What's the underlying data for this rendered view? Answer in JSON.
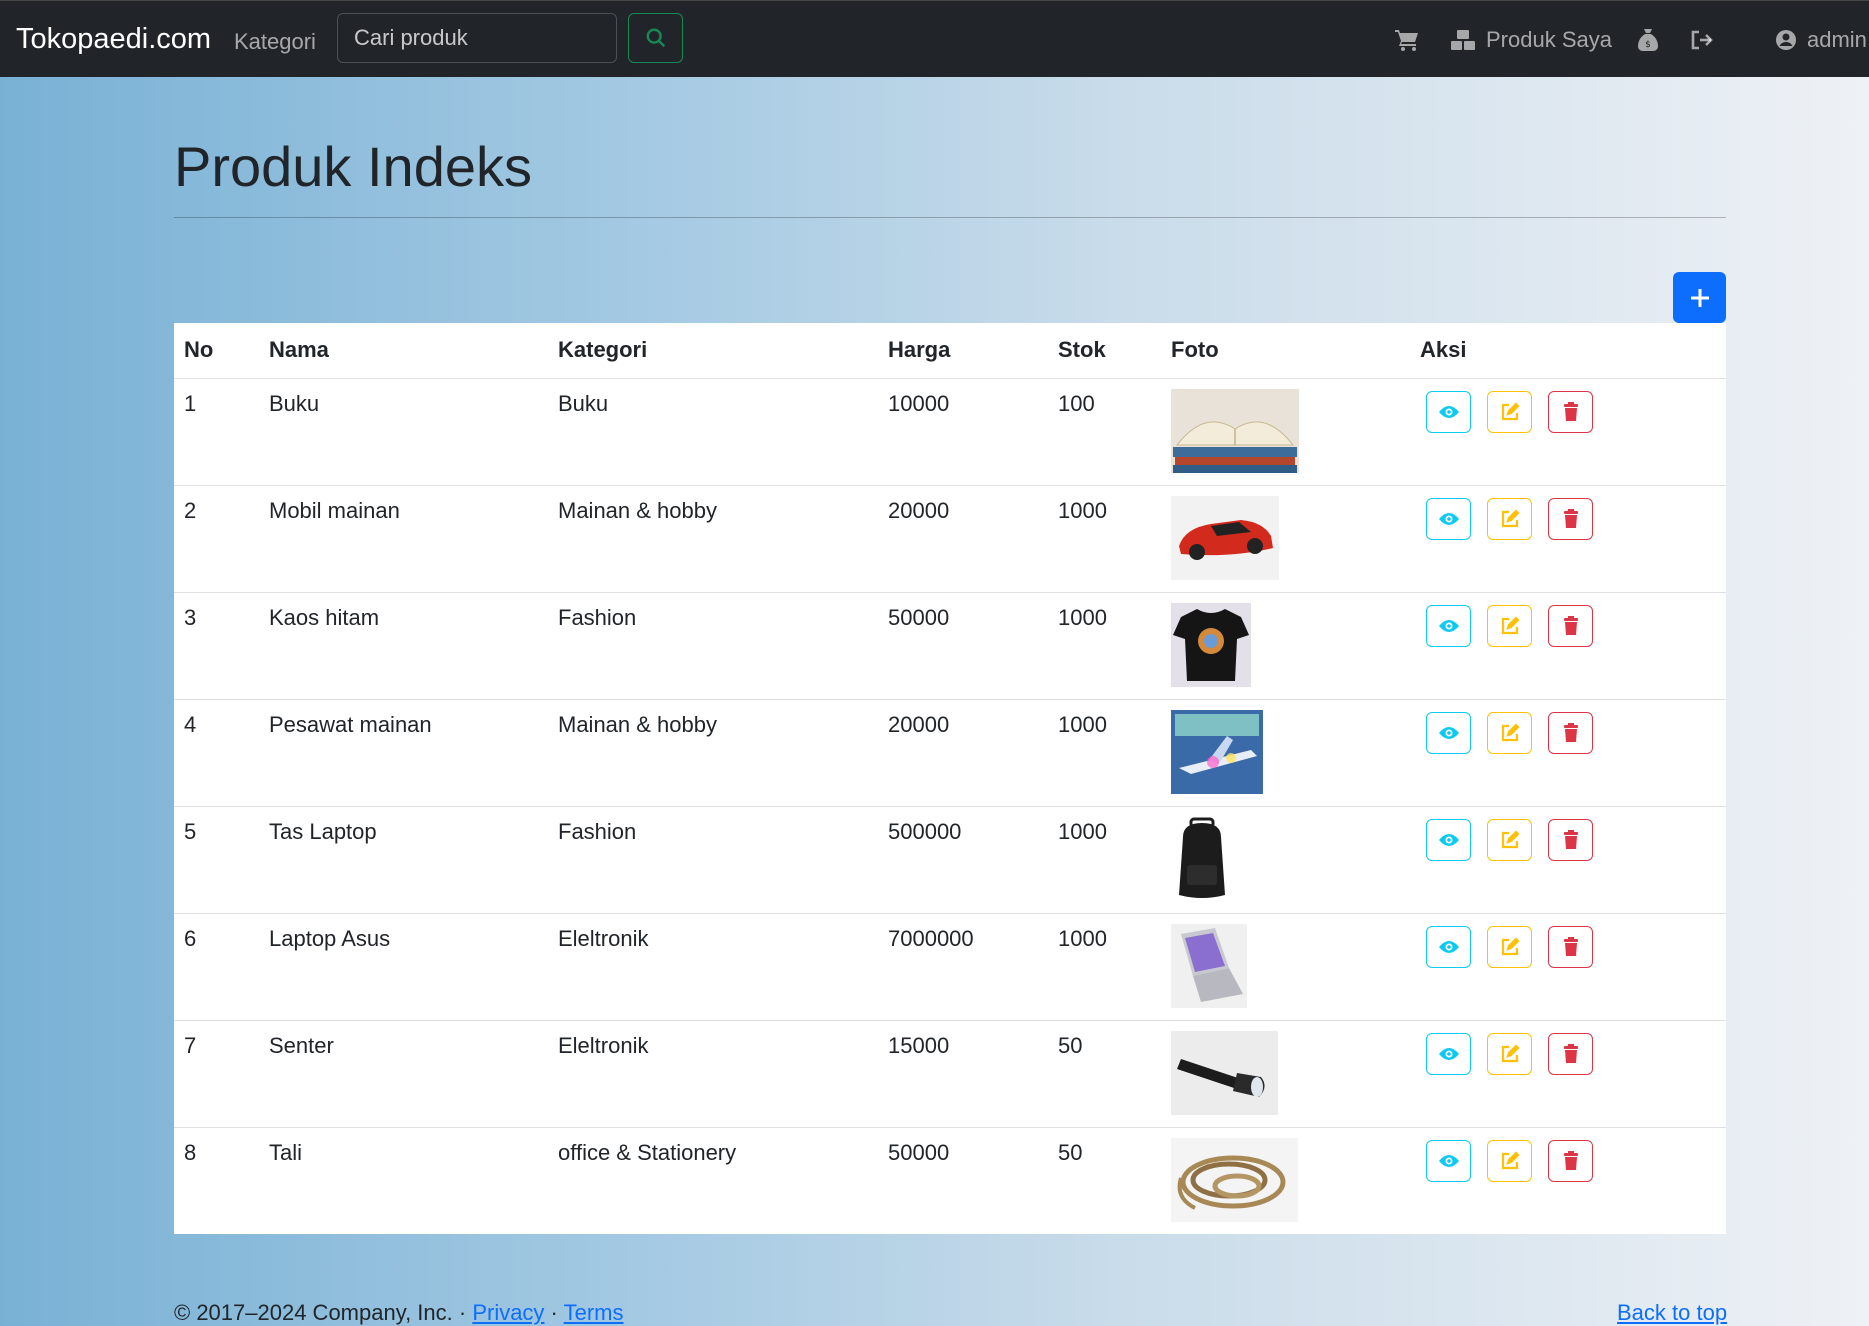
{
  "navbar": {
    "brand": "Tokopaedi.com",
    "kategori": "Kategori",
    "search_placeholder": "Cari produk",
    "produk_saya": "Produk Saya",
    "admin": "admin"
  },
  "page": {
    "title": "Produk Indeks"
  },
  "table": {
    "headers": {
      "no": "No",
      "nama": "Nama",
      "kategori": "Kategori",
      "harga": "Harga",
      "stok": "Stok",
      "foto": "Foto",
      "aksi": "Aksi"
    },
    "rows": [
      {
        "no": "1",
        "nama": "Buku",
        "kategori": "Buku",
        "harga": "10000",
        "stok": "100",
        "foto": "books"
      },
      {
        "no": "2",
        "nama": "Mobil mainan",
        "kategori": "Mainan & hobby",
        "harga": "20000",
        "stok": "1000",
        "foto": "toy-car"
      },
      {
        "no": "3",
        "nama": "Kaos hitam",
        "kategori": "Fashion",
        "harga": "50000",
        "stok": "1000",
        "foto": "black-tshirt"
      },
      {
        "no": "4",
        "nama": "Pesawat mainan",
        "kategori": "Mainan & hobby",
        "harga": "20000",
        "stok": "1000",
        "foto": "toy-plane"
      },
      {
        "no": "5",
        "nama": "Tas Laptop",
        "kategori": "Fashion",
        "harga": "500000",
        "stok": "1000",
        "foto": "backpack"
      },
      {
        "no": "6",
        "nama": "Laptop Asus",
        "kategori": "Eleltronik",
        "harga": "7000000",
        "stok": "1000",
        "foto": "laptop"
      },
      {
        "no": "7",
        "nama": "Senter",
        "kategori": "Eleltronik",
        "harga": "15000",
        "stok": "50",
        "foto": "flashlight"
      },
      {
        "no": "8",
        "nama": "Tali",
        "kategori": "office & Stationery",
        "harga": "50000",
        "stok": "50",
        "foto": "rope"
      }
    ]
  },
  "footer": {
    "copyright": "© 2017–2024 Company, Inc. · ",
    "privacy": "Privacy",
    "dot": " · ",
    "terms": "Terms",
    "back_to_top": "Back to top"
  },
  "colors": {
    "navbar": "#212529",
    "primary": "#0d6efd",
    "info": "#0dcaf0",
    "warning": "#ffc107",
    "danger": "#dc3545",
    "success": "#198754"
  }
}
